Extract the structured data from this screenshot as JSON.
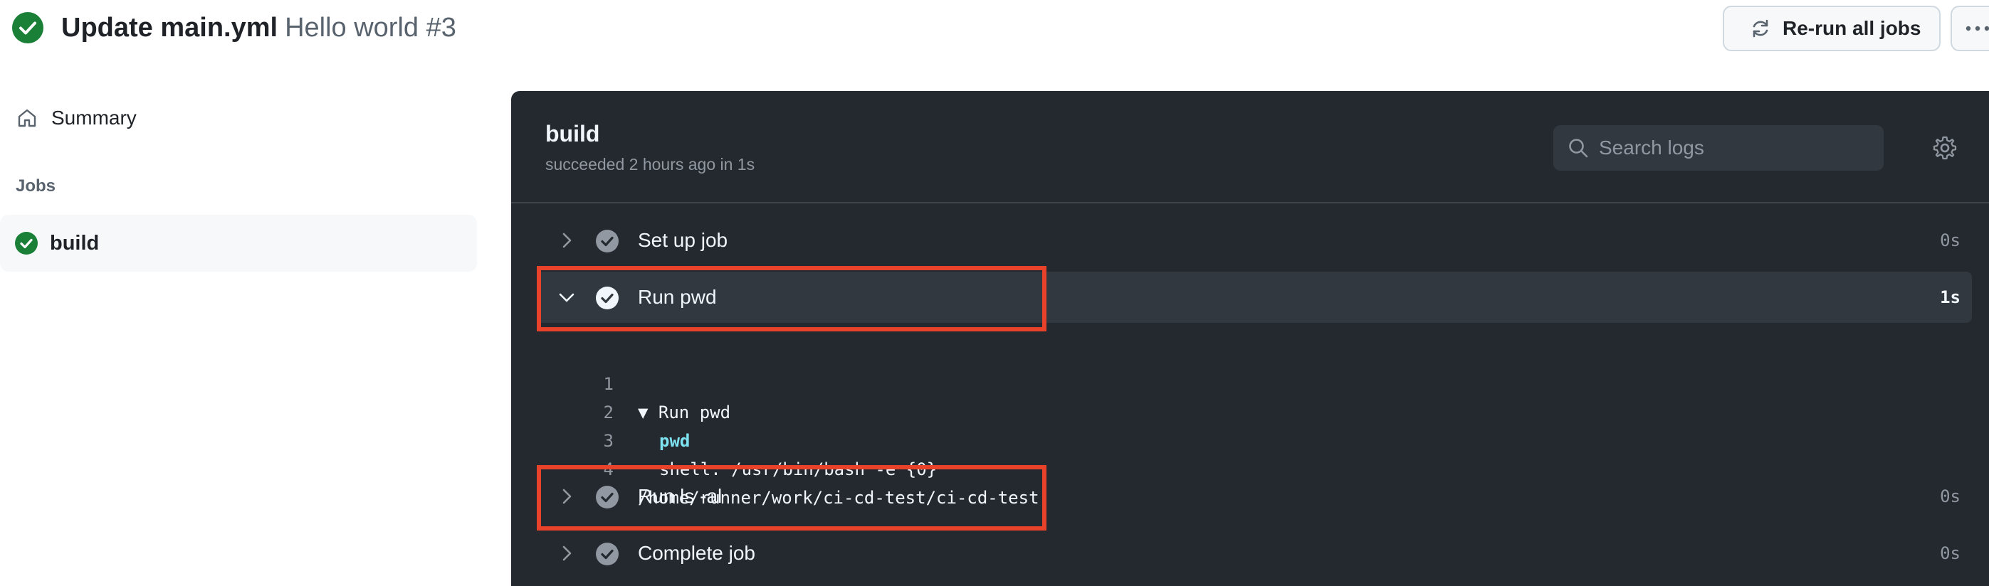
{
  "header": {
    "title": "Update main.yml",
    "subtitle": "Hello world #3",
    "rerun_label": "Re-run all jobs",
    "status_icon": "check-circle-fill-icon",
    "status_color": "#1a7f37"
  },
  "sidebar": {
    "summary_label": "Summary",
    "jobs_heading": "Jobs",
    "jobs": [
      {
        "label": "build",
        "status": "success"
      }
    ]
  },
  "log_panel": {
    "job_title": "build",
    "job_meta": "succeeded 2 hours ago in 1s",
    "search_placeholder": "Search logs",
    "steps": [
      {
        "name": "Set up job",
        "duration": "0s",
        "expanded": false
      },
      {
        "name": "Run pwd",
        "duration": "1s",
        "expanded": true
      },
      {
        "name": "Run ls -al",
        "duration": "0s",
        "expanded": false
      },
      {
        "name": "Complete job",
        "duration": "0s",
        "expanded": false
      }
    ],
    "log_lines": [
      {
        "num": "1",
        "text": "▼ Run pwd"
      },
      {
        "num": "2",
        "text": "pwd"
      },
      {
        "num": "3",
        "text": "shell: /usr/bin/bash -e {0}"
      },
      {
        "num": "4",
        "text": "/home/runner/work/ci-cd-test/ci-cd-test"
      }
    ]
  },
  "colors": {
    "success": "#1a7f37",
    "panel_bg": "#24292f",
    "highlight": "#e8432a",
    "command": "#7ee2f0"
  }
}
